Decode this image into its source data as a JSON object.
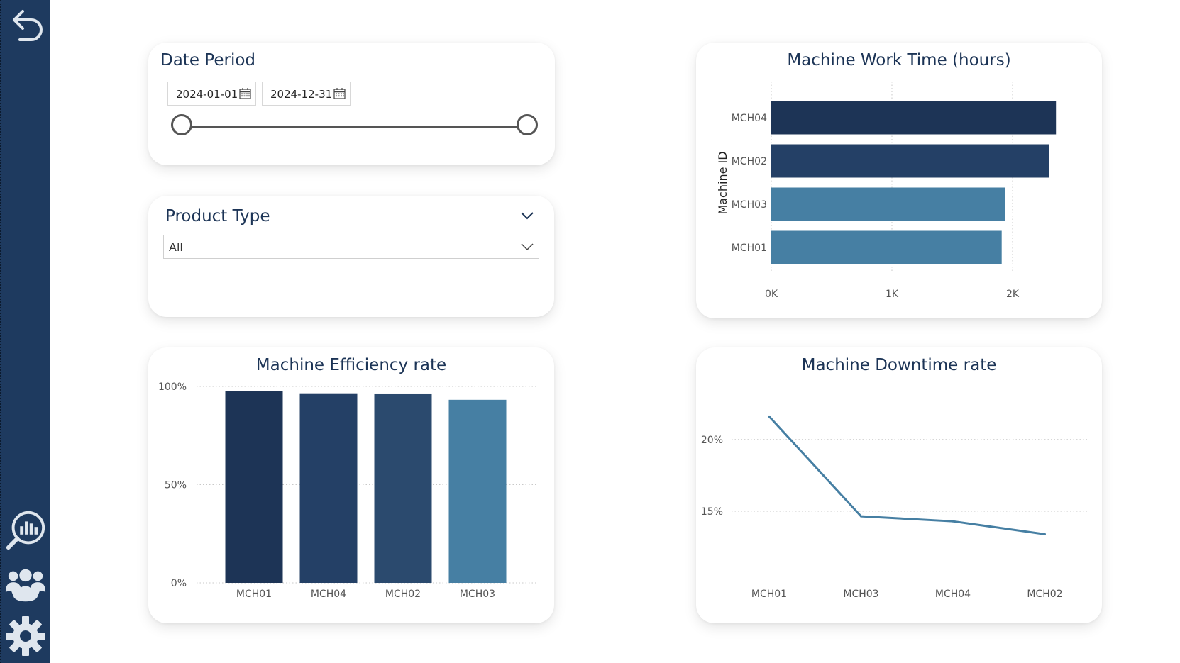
{
  "colors": {
    "sidebar": "#1e3a5f",
    "dark_navy": "#1d3456",
    "mid_navy": "#244066",
    "slate_blue": "#2b4a6e",
    "steel_blue": "#467fa3",
    "title_text": "#1c3456"
  },
  "sidebar": {
    "items": [
      {
        "icon": "back-arrow-icon"
      },
      {
        "icon": "analytics-search-icon"
      },
      {
        "icon": "team-icon"
      },
      {
        "icon": "gear-icon"
      }
    ]
  },
  "date_period": {
    "title": "Date Period",
    "start_date": "2024-01-01",
    "end_date": "2024-12-31",
    "range_fraction": [
      0,
      1
    ]
  },
  "product_type": {
    "title": "Product Type",
    "selected": "All"
  },
  "charts": {
    "work_time": {
      "title": "Machine Work Time (hours)",
      "ylabel": "Machine ID"
    },
    "efficiency": {
      "title": "Machine Efficiency rate"
    },
    "downtime": {
      "title": "Machine Downtime rate"
    }
  },
  "chart_data": [
    {
      "id": "work_time",
      "type": "bar",
      "orientation": "horizontal",
      "title": "Machine Work Time (hours)",
      "xlabel": "",
      "ylabel": "Machine ID",
      "categories": [
        "MCH04",
        "MCH02",
        "MCH03",
        "MCH01"
      ],
      "values": [
        2360,
        2300,
        1940,
        1910
      ],
      "colors": [
        "#1d3456",
        "#244066",
        "#467fa3",
        "#467fa3"
      ],
      "xlim": [
        0,
        2400
      ],
      "xticks": [
        0,
        1000,
        2000
      ],
      "xtick_labels": [
        "0K",
        "1K",
        "2K"
      ],
      "grid": "vertical-dotted"
    },
    {
      "id": "efficiency",
      "type": "bar",
      "title": "Machine Efficiency rate",
      "xlabel": "",
      "ylabel": "",
      "categories": [
        "MCH01",
        "MCH04",
        "MCH02",
        "MCH03"
      ],
      "values": [
        0.977,
        0.965,
        0.964,
        0.932
      ],
      "colors": [
        "#1d3456",
        "#244066",
        "#2b4a6e",
        "#467fa3"
      ],
      "ylim": [
        0,
        1
      ],
      "yticks": [
        0,
        0.5,
        1
      ],
      "ytick_labels": [
        "0%",
        "50%",
        "100%"
      ],
      "grid": "horizontal-dotted"
    },
    {
      "id": "downtime",
      "type": "line",
      "title": "Machine Downtime rate",
      "xlabel": "",
      "ylabel": "",
      "categories": [
        "MCH01",
        "MCH03",
        "MCH04",
        "MCH02"
      ],
      "values": [
        0.216,
        0.1465,
        0.143,
        0.134
      ],
      "color": "#467fa3",
      "ylim": [
        0.11,
        0.232
      ],
      "yticks": [
        0.15,
        0.2
      ],
      "ytick_labels": [
        "15%",
        "20%"
      ],
      "grid": "horizontal-dotted"
    }
  ]
}
